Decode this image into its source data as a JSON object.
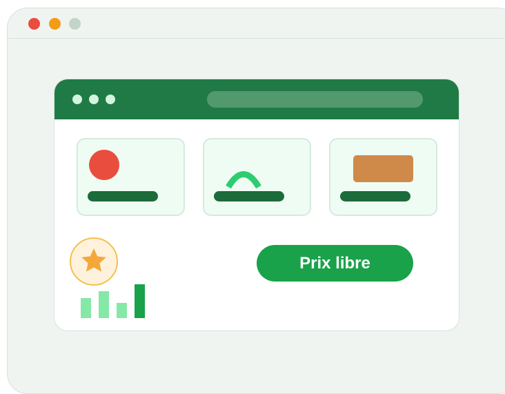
{
  "outer_window": {
    "controls": [
      {
        "name": "close",
        "color": "#ea4c3e"
      },
      {
        "name": "minimize",
        "color": "#f39c14"
      },
      {
        "name": "maximize",
        "color": "#c3d4cb"
      }
    ]
  },
  "app": {
    "header_color": "#207a45",
    "tiles": [
      {
        "icon": "circle-icon",
        "color": "#e94d3e"
      },
      {
        "icon": "arch-icon",
        "color": "#2ecc71"
      },
      {
        "icon": "rectangle-icon",
        "color": "#cf8a4a"
      }
    ],
    "badge": {
      "icon": "star-icon",
      "color": "#f5a83a"
    },
    "mini_chart": {
      "icon": "bar-chart-icon",
      "values": [
        29,
        39,
        22,
        49
      ],
      "colors": [
        "#86e8a6",
        "#86e8a6",
        "#86e8a6",
        "#19a24a"
      ]
    },
    "cta": {
      "label": "Prix libre",
      "color": "#19a24a"
    }
  }
}
